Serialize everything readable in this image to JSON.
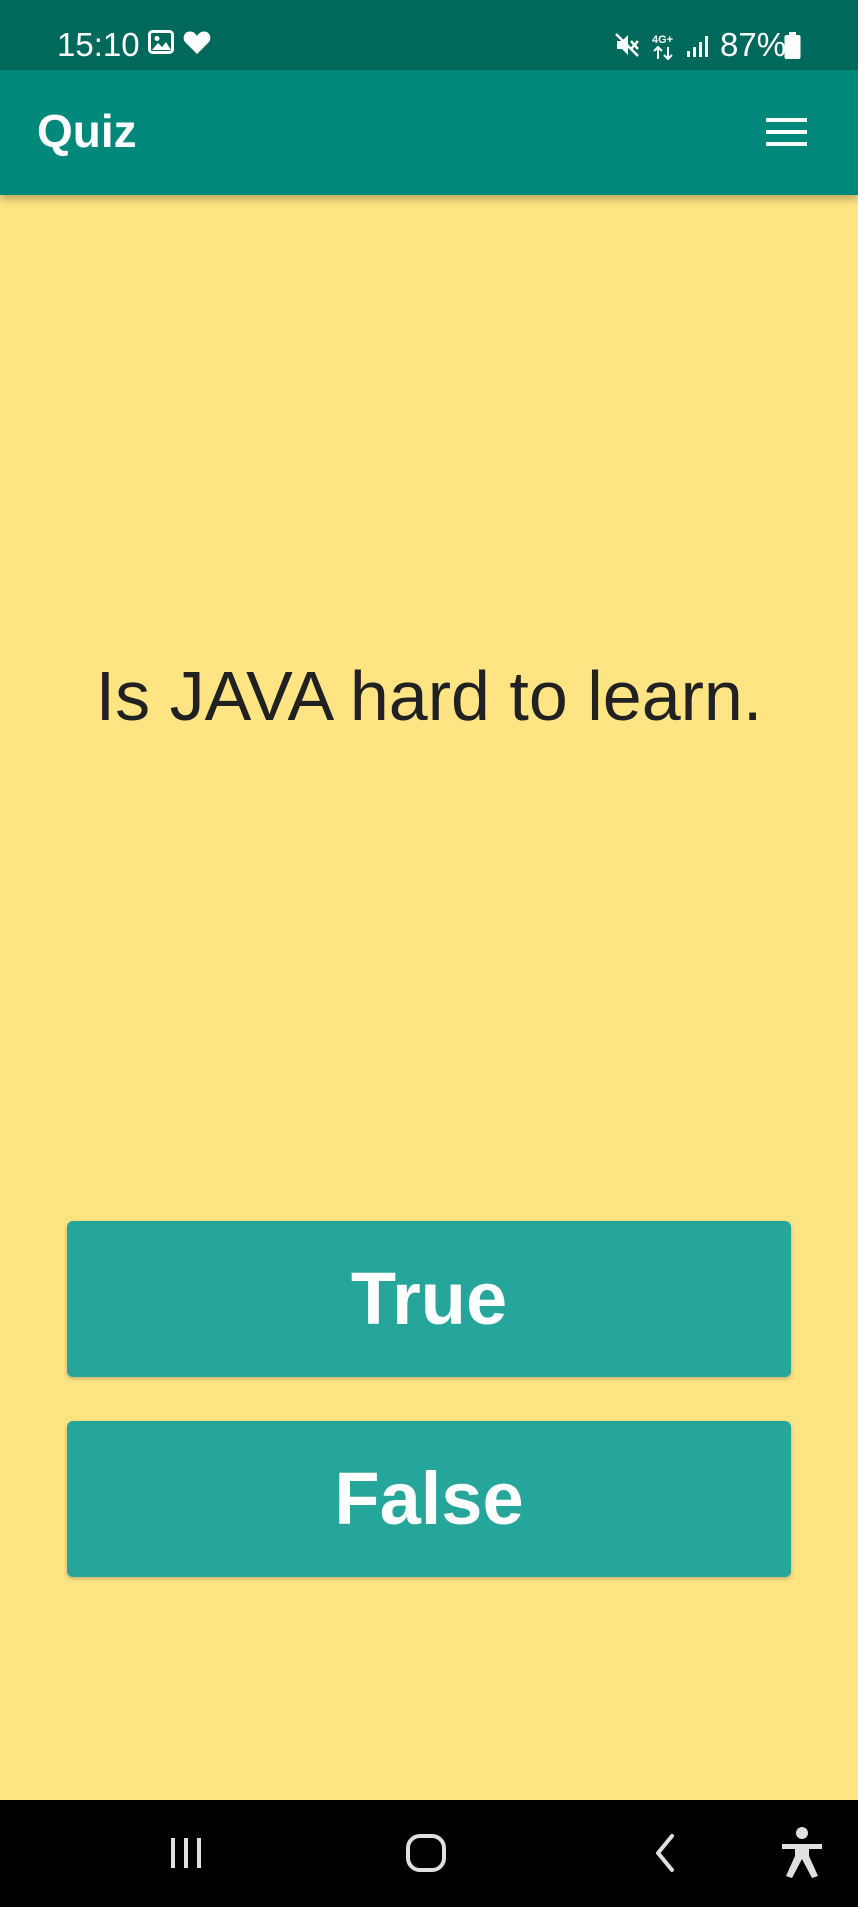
{
  "status_bar": {
    "time": "15:10",
    "battery": "87%",
    "icons": [
      "gallery-icon",
      "heart-icon",
      "mute-icon",
      "4g-data-icon",
      "signal-icon",
      "battery-icon"
    ]
  },
  "app_bar": {
    "title": "Quiz",
    "menu_icon": "hamburger-menu-icon"
  },
  "quiz": {
    "question": "Is JAVA hard to learn.",
    "true_label": "True",
    "false_label": "False"
  },
  "nav_bar": {
    "icons": [
      "recent-apps-icon",
      "home-icon",
      "back-icon",
      "accessibility-icon"
    ]
  },
  "colors": {
    "status_bar": "#00695C",
    "app_bar": "#00897B",
    "background": "#FFE483",
    "button": "#26A69A",
    "question_text": "#212121"
  }
}
